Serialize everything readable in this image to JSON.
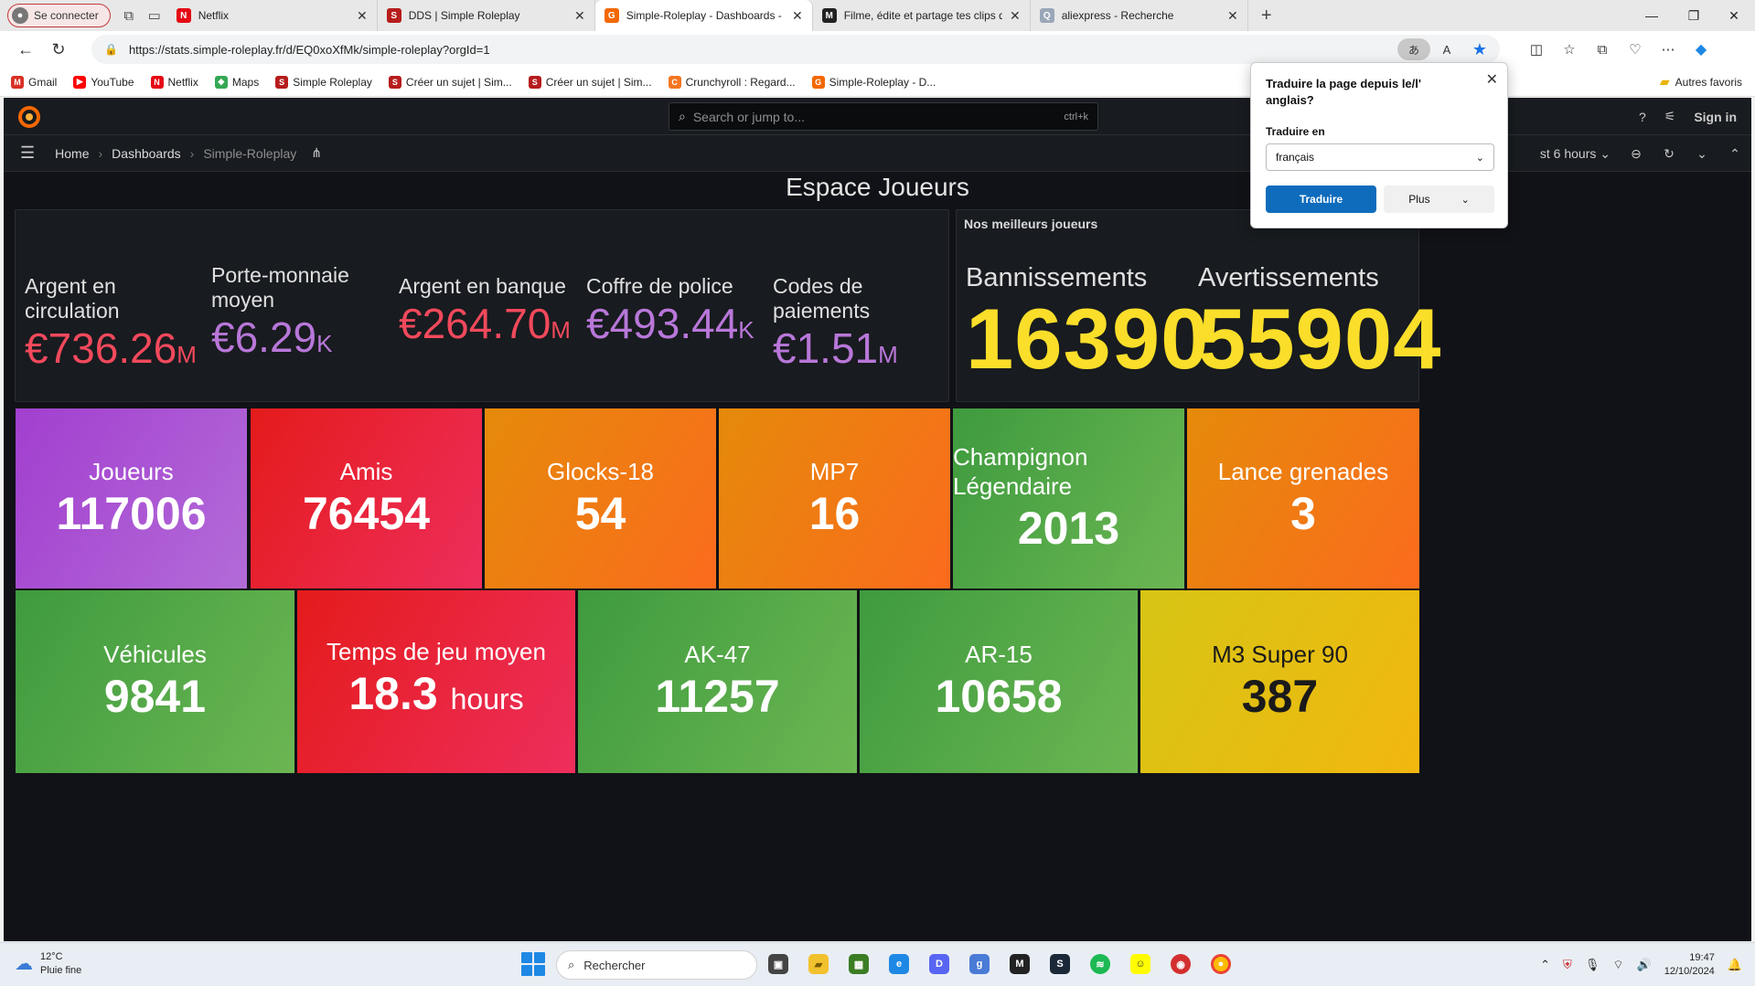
{
  "browser": {
    "profile_label": "Se connecter",
    "tabs": [
      {
        "label": "Netflix",
        "fav": "N",
        "color": "#e50914"
      },
      {
        "label": "DDS | Simple Roleplay",
        "fav": "S",
        "color": "#b71c1c"
      },
      {
        "label": "Simple-Roleplay - Dashboards - G",
        "fav": "G",
        "color": "#f46800"
      },
      {
        "label": "Filme, édite et partage tes clips de",
        "fav": "M",
        "color": "#222222"
      },
      {
        "label": "aliexpress - Recherche",
        "fav": "Q",
        "color": "#9aa7b8"
      }
    ],
    "url": "https://stats.simple-roleplay.fr/d/EQ0xoXfMk/simple-roleplay?orgId=1",
    "bookmarks": [
      {
        "label": "Gmail",
        "fav": "M",
        "color": "#d93025"
      },
      {
        "label": "YouTube",
        "fav": "▶",
        "color": "#ff0000"
      },
      {
        "label": "Netflix",
        "fav": "N",
        "color": "#e50914"
      },
      {
        "label": "Maps",
        "fav": "◆",
        "color": "#34a853"
      },
      {
        "label": "Simple Roleplay",
        "fav": "S",
        "color": "#b71c1c"
      },
      {
        "label": "Créer un sujet | Sim...",
        "fav": "S",
        "color": "#b71c1c"
      },
      {
        "label": "Créer un sujet | Sim...",
        "fav": "S",
        "color": "#b71c1c"
      },
      {
        "label": "Crunchyroll : Regard...",
        "fav": "C",
        "color": "#f47521"
      },
      {
        "label": "Simple-Roleplay - D...",
        "fav": "G",
        "color": "#f46800"
      }
    ],
    "other_bookmarks": "Autres favoris"
  },
  "translate_popup": {
    "title": "Traduire la page depuis le/l' anglais?",
    "subtitle": "Traduire en",
    "language": "français",
    "primary": "Traduire",
    "secondary": "Plus"
  },
  "grafana": {
    "search_placeholder": "Search or jump to...",
    "search_shortcut": "ctrl+k",
    "sign_in": "Sign in",
    "breadcrumb": [
      "Home",
      "Dashboards",
      "Simple-Roleplay"
    ],
    "time_range": "st 6 hours",
    "dashboard_title": "Espace Joueurs",
    "money_stats": [
      {
        "label": "Argent en circulation",
        "value": "€736.26",
        "unit": "M",
        "color": "#f2495c"
      },
      {
        "label": "Porte-monnaie moyen",
        "value": "€6.29",
        "unit": "K",
        "color": "#b877d9"
      },
      {
        "label": "Argent en banque",
        "value": "€264.70",
        "unit": "M",
        "color": "#f2495c"
      },
      {
        "label": "Coffre de police",
        "value": "€493.44",
        "unit": "K",
        "color": "#b877d9"
      },
      {
        "label": "Codes de paiements",
        "value": "€1.51",
        "unit": "M",
        "color": "#b877d9"
      }
    ],
    "best_players": {
      "title": "Nos meilleurs joueurs",
      "items": [
        {
          "label": "Bannissements",
          "value": "16390"
        },
        {
          "label": "Avertissements",
          "value": "55904"
        }
      ]
    },
    "tiles_row1": [
      {
        "label": "Joueurs",
        "value": "117006",
        "unit": "",
        "bg": "linear-gradient(120deg,#a23fcf,#b36bd8)",
        "fg": "#ffffff"
      },
      {
        "label": "Amis",
        "value": "76454",
        "unit": "",
        "bg": "linear-gradient(120deg,#e41b1b,#ee2e5c)",
        "fg": "#ffffff"
      },
      {
        "label": "Glocks-18",
        "value": "54",
        "unit": "",
        "bg": "linear-gradient(120deg,#e58a0a,#fb6b1d)",
        "fg": "#ffffff"
      },
      {
        "label": "MP7",
        "value": "16",
        "unit": "",
        "bg": "linear-gradient(120deg,#e58a0a,#fb6b1d)",
        "fg": "#ffffff"
      },
      {
        "label": "Champignon Légendaire",
        "value": "2013",
        "unit": "",
        "bg": "linear-gradient(120deg,#3e9b3e,#6cb653)",
        "fg": "#ffffff"
      },
      {
        "label": "Lance grenades",
        "value": "3",
        "unit": "",
        "bg": "linear-gradient(120deg,#e58a0a,#fb6b1d)",
        "fg": "#ffffff"
      }
    ],
    "tiles_row2": [
      {
        "label": "Véhicules",
        "value": "9841",
        "unit": "",
        "bg": "linear-gradient(120deg,#3e9b3e,#6cb653)",
        "fg": "#ffffff"
      },
      {
        "label": "Temps de jeu moyen",
        "value": "18.3",
        "unit": "hours",
        "bg": "linear-gradient(120deg,#e41b1b,#ee2e5c)",
        "fg": "#ffffff"
      },
      {
        "label": "AK-47",
        "value": "11257",
        "unit": "",
        "bg": "linear-gradient(120deg,#3e9b3e,#6cb653)",
        "fg": "#ffffff"
      },
      {
        "label": "AR-15",
        "value": "10658",
        "unit": "",
        "bg": "linear-gradient(120deg,#3e9b3e,#6cb653)",
        "fg": "#ffffff"
      },
      {
        "label": "M3 Super 90",
        "value": "387",
        "unit": "",
        "bg": "linear-gradient(120deg,#d6c514,#f2b70f)",
        "fg": "#1a1a1a"
      }
    ]
  },
  "taskbar": {
    "temperature": "12°C",
    "weather": "Pluie fine",
    "search_label": "Rechercher",
    "time": "19:47",
    "date": "12/10/2024"
  }
}
